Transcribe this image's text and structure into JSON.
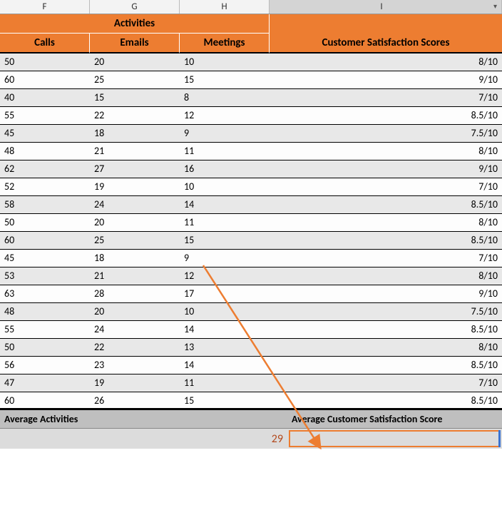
{
  "columns": {
    "F": "F",
    "G": "G",
    "H": "H",
    "I": "I"
  },
  "headers": {
    "activities": "Activities",
    "satisfaction": "Customer Satisfaction Scores",
    "calls": "Calls",
    "emails": "Emails",
    "meetings": "Meetings"
  },
  "rows": [
    {
      "calls": "50",
      "emails": "20",
      "meetings": "10",
      "score": "8/10"
    },
    {
      "calls": "60",
      "emails": "25",
      "meetings": "15",
      "score": "9/10"
    },
    {
      "calls": "40",
      "emails": "15",
      "meetings": "8",
      "score": "7/10"
    },
    {
      "calls": "55",
      "emails": "22",
      "meetings": "12",
      "score": "8.5/10"
    },
    {
      "calls": "45",
      "emails": "18",
      "meetings": "9",
      "score": "7.5/10"
    },
    {
      "calls": "48",
      "emails": "21",
      "meetings": "11",
      "score": "8/10"
    },
    {
      "calls": "62",
      "emails": "27",
      "meetings": "16",
      "score": "9/10"
    },
    {
      "calls": "52",
      "emails": "19",
      "meetings": "10",
      "score": "7/10"
    },
    {
      "calls": "58",
      "emails": "24",
      "meetings": "14",
      "score": "8.5/10"
    },
    {
      "calls": "50",
      "emails": "20",
      "meetings": "11",
      "score": "8/10"
    },
    {
      "calls": "60",
      "emails": "25",
      "meetings": "15",
      "score": "8.5/10"
    },
    {
      "calls": "45",
      "emails": "18",
      "meetings": "9",
      "score": "7/10"
    },
    {
      "calls": "53",
      "emails": "21",
      "meetings": "12",
      "score": "8/10"
    },
    {
      "calls": "63",
      "emails": "28",
      "meetings": "17",
      "score": "9/10"
    },
    {
      "calls": "48",
      "emails": "20",
      "meetings": "10",
      "score": "7.5/10"
    },
    {
      "calls": "55",
      "emails": "24",
      "meetings": "14",
      "score": "8.5/10"
    },
    {
      "calls": "50",
      "emails": "22",
      "meetings": "13",
      "score": "8/10"
    },
    {
      "calls": "56",
      "emails": "23",
      "meetings": "14",
      "score": "8.5/10"
    },
    {
      "calls": "47",
      "emails": "19",
      "meetings": "11",
      "score": "7/10"
    },
    {
      "calls": "60",
      "emails": "26",
      "meetings": "15",
      "score": "8.5/10"
    }
  ],
  "footer": {
    "avg_activities_label": "Average Activities",
    "avg_satisfaction_label": "Average Customer Satisfaction Score",
    "avg_activities_value": "29"
  },
  "dropdown_glyph": "▾"
}
